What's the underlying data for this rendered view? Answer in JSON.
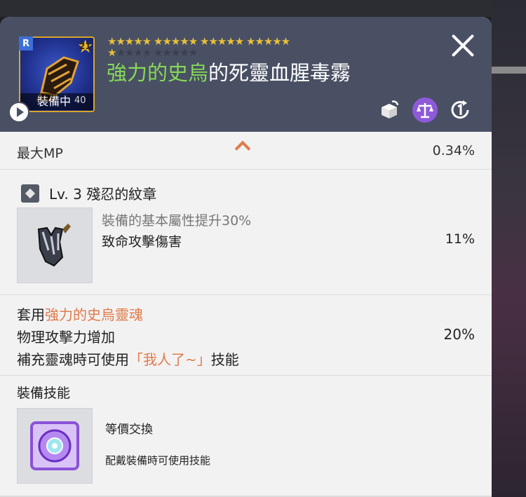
{
  "header": {
    "rank": "R",
    "star_level": "21",
    "equipped_label": "裝備中",
    "equipped_num": "40",
    "stars_row1": "★★★★★ ★★★★★ ★★★★★ ★★★★★",
    "stars_row2_on": "★",
    "stars_row2_off": "★★★★ ★★★★★",
    "title_highlight": "強力的史烏",
    "title_rest": "的死靈血腥毒霧",
    "icons": [
      "close-icon",
      "box-icon",
      "scale-icon",
      "one-icon"
    ],
    "accent_color": "#86d957"
  },
  "max_mp": {
    "label": "最大MP",
    "value": "0.34%"
  },
  "emblem": {
    "title": "Lv. 3 殘忍的紋章",
    "sub": "裝備的基本屬性提升30%",
    "stat": "致命攻擊傷害",
    "value": "11%"
  },
  "soul": {
    "prefix": "套用",
    "name": "強力的史烏靈魂",
    "stat": "物理攻擊力增加",
    "value": "20%",
    "skill_prefix": "補充靈魂時可使用",
    "skill_name": "「我人了~」",
    "skill_suffix": "技能"
  },
  "equip_skill": {
    "heading": "裝備技能",
    "name": "等價交換",
    "desc": "配戴裝備時可使用技能"
  }
}
